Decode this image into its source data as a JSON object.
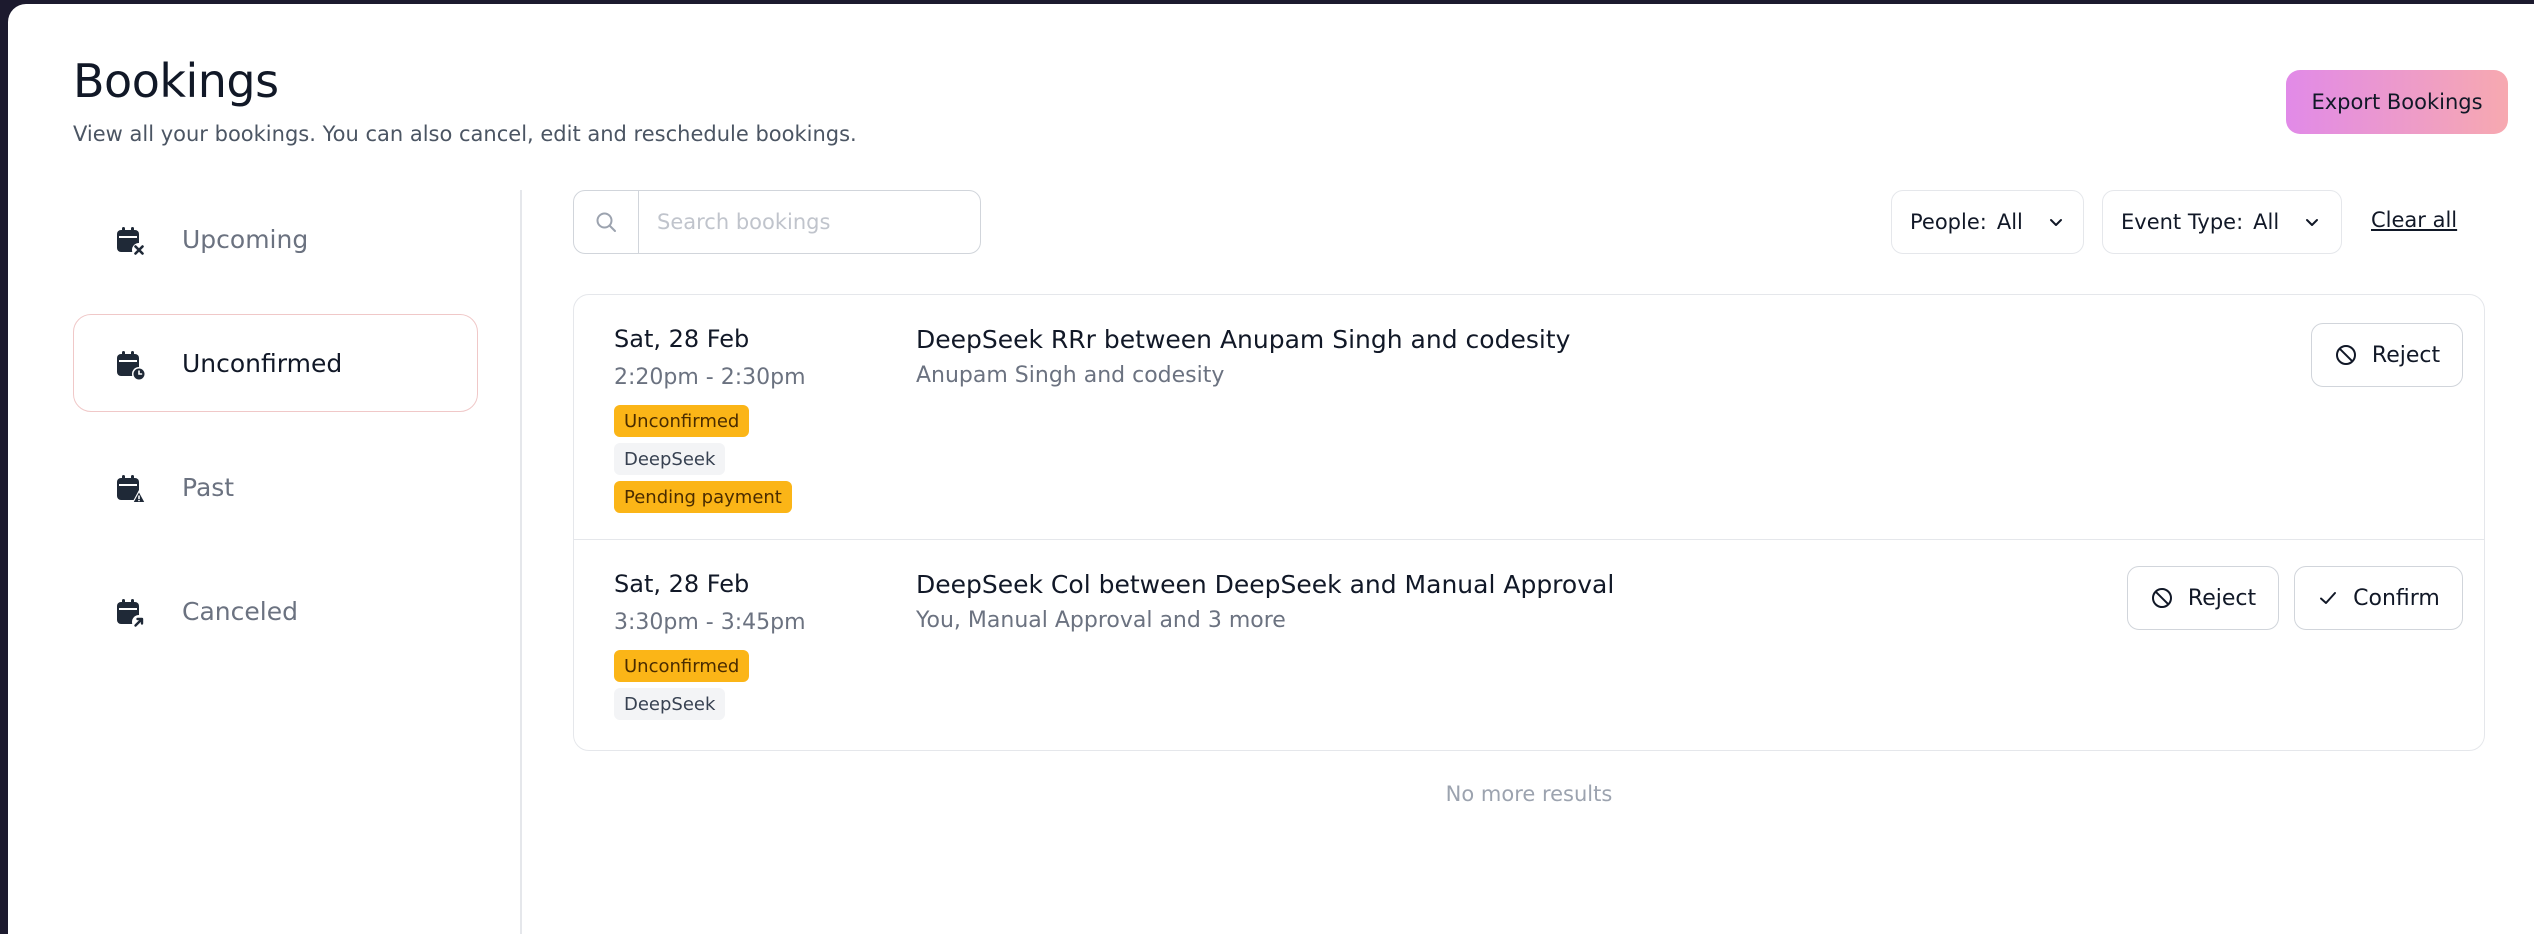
{
  "header": {
    "title": "Bookings",
    "subtitle": "View all your bookings. You can also cancel, edit and reschedule bookings.",
    "export_label": "Export Bookings"
  },
  "sidebar": {
    "items": [
      {
        "label": "Upcoming",
        "icon": "calendar-x-icon",
        "active": false
      },
      {
        "label": "Unconfirmed",
        "icon": "calendar-clock-icon",
        "active": true
      },
      {
        "label": "Past",
        "icon": "calendar-alert-icon",
        "active": false
      },
      {
        "label": "Canceled",
        "icon": "calendar-arrow-icon",
        "active": false
      }
    ]
  },
  "search": {
    "placeholder": "Search bookings",
    "value": ""
  },
  "filters": {
    "people_label": "People:",
    "people_value": "All",
    "event_type_label": "Event Type:",
    "event_type_value": "All",
    "clear_all": "Clear all"
  },
  "bookings": [
    {
      "date": "Sat, 28 Feb",
      "time": "2:20pm - 2:30pm",
      "status_badge": "Unconfirmed",
      "event_badge": "DeepSeek",
      "payment_badge": "Pending payment",
      "title": "DeepSeek RRr between Anupam Singh and codesity",
      "attendees": "Anupam Singh and codesity",
      "reject_label": "Reject"
    },
    {
      "date": "Sat, 28 Feb",
      "time": "3:30pm - 3:45pm",
      "status_badge": "Unconfirmed",
      "event_badge": "DeepSeek",
      "title": "DeepSeek Col between DeepSeek and Manual Approval",
      "attendees": "You, Manual Approval and 3 more",
      "reject_label": "Reject",
      "confirm_label": "Confirm"
    }
  ],
  "footer": {
    "no_more": "No more results"
  },
  "colors": {
    "warning_badge": "#fbb517",
    "export_gradient_start": "#e18ae8",
    "export_gradient_end": "#f7a9b0",
    "active_border": "#f0c8c8"
  }
}
